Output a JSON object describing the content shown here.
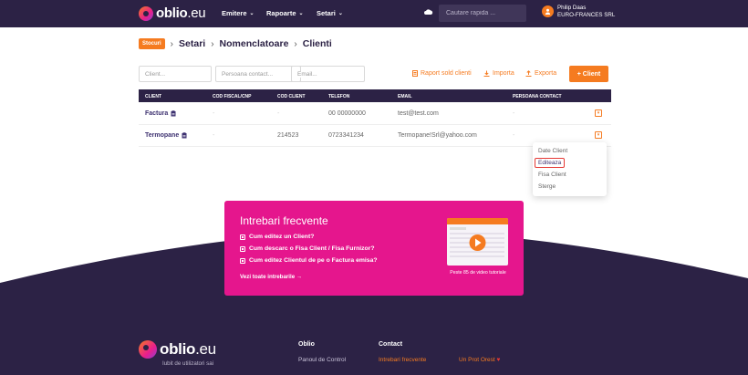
{
  "colors": {
    "navy": "#2c2245",
    "orange": "#f57b20",
    "pink": "#e5168d",
    "purple_text": "#3d3170"
  },
  "header": {
    "brand": "oblio",
    "brand_tld": ".eu",
    "nav": [
      {
        "label": "Emitere",
        "icon": "chevron-down-icon"
      },
      {
        "label": "Rapoarte",
        "icon": "chevron-down-icon"
      },
      {
        "label": "Setari",
        "icon": "chevron-down-icon"
      }
    ],
    "search_placeholder": "Cautare rapida ...",
    "user_name": "Philip Daas",
    "company": "EURO-FRANCES SRL"
  },
  "breadcrumb": {
    "badge": "Stocuri",
    "items": [
      "Setari",
      "Nomenclatoare",
      "Clienti"
    ],
    "separator": "›"
  },
  "filters": {
    "client_placeholder": "Client...",
    "contact_placeholder": "Persoana contact...",
    "email_placeholder": "Email..."
  },
  "actions": {
    "report": "Raport sold clienti",
    "import": "Importa",
    "export": "Exporta",
    "add": "+ Client"
  },
  "table": {
    "columns": [
      "CLIENT",
      "COD FISCAL/CNP",
      "COD CLIENT",
      "TELEFON",
      "EMAIL",
      "PERSOANA CONTACT"
    ],
    "rows": [
      {
        "client": "Factura",
        "cod_fiscal": "-",
        "cod_client": "-",
        "telefon": "00 00000000",
        "email": "test@test.com",
        "contact": "-"
      },
      {
        "client": "Termopane",
        "cod_fiscal": "-",
        "cod_client": "214523",
        "telefon": "0723341234",
        "email": "Termopane!Srl@yahoo.com",
        "contact": "-"
      }
    ]
  },
  "dropdown": {
    "items": [
      "Date Client",
      "Editeaza",
      "Fisa Client",
      "Sterge"
    ],
    "active_index": 1
  },
  "faq": {
    "title": "Intrebari frecvente",
    "questions": [
      "Cum editez un Client?",
      "Cum descarc o Fisa Client / Fisa Furnizor?",
      "Cum editez Clientul de pe o Factura emisa?"
    ],
    "all_link": "Vezi toate intrebarile",
    "video_caption": "Peste 85 de video tutoriale"
  },
  "footer": {
    "tagline": "Iubit de utilizatori sai",
    "col1_title": "Oblio",
    "col1_links": [
      "Panoul de Control"
    ],
    "col2_title": "Contact",
    "col2_links": [
      "Intrebari frecvente"
    ],
    "col3_links": [
      "Un Prot Orest"
    ]
  }
}
